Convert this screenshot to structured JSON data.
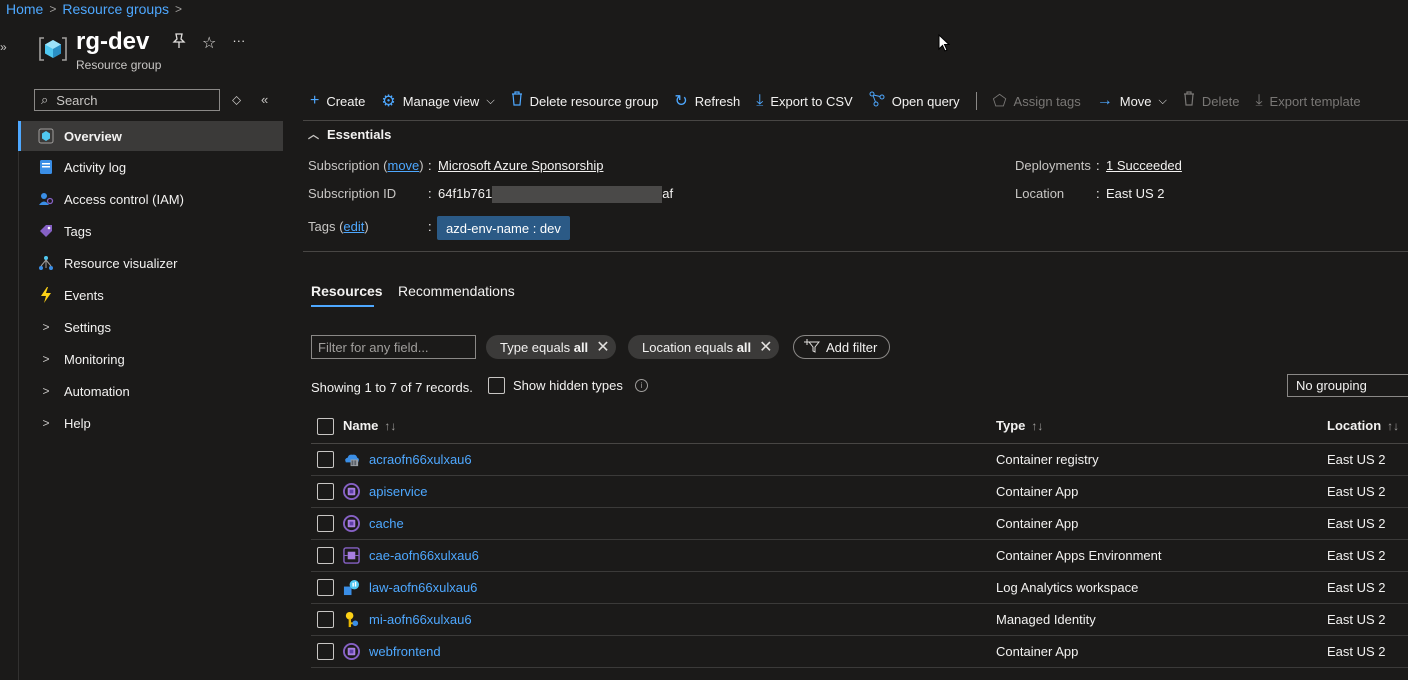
{
  "breadcrumb": {
    "home": "Home",
    "resource_groups": "Resource groups"
  },
  "header": {
    "title": "rg-dev",
    "subtitle": "Resource group",
    "more": "···"
  },
  "sidebar": {
    "search_placeholder": "Search",
    "items": [
      {
        "label": "Overview",
        "icon": "overview-icon"
      },
      {
        "label": "Activity log",
        "icon": "activity-log-icon"
      },
      {
        "label": "Access control (IAM)",
        "icon": "iam-icon"
      },
      {
        "label": "Tags",
        "icon": "tag-icon"
      },
      {
        "label": "Resource visualizer",
        "icon": "visualizer-icon"
      },
      {
        "label": "Events",
        "icon": "lightning-icon"
      },
      {
        "label": "Settings",
        "icon": "chevron-right-icon"
      },
      {
        "label": "Monitoring",
        "icon": "chevron-right-icon"
      },
      {
        "label": "Automation",
        "icon": "chevron-right-icon"
      },
      {
        "label": "Help",
        "icon": "chevron-right-icon"
      }
    ]
  },
  "toolbar": {
    "create": "Create",
    "manage_view": "Manage view",
    "delete_rg": "Delete resource group",
    "refresh": "Refresh",
    "export_csv": "Export to CSV",
    "open_query": "Open query",
    "assign_tags": "Assign tags",
    "move": "Move",
    "delete": "Delete",
    "export_template": "Export template"
  },
  "essentials": {
    "heading": "Essentials",
    "subscription_label": "Subscription (",
    "subscription_move": "move",
    "subscription_label_end": ")",
    "subscription_value": "Microsoft Azure Sponsorship",
    "subscription_id_label": "Subscription ID",
    "subscription_id_start": "64f1b761",
    "subscription_id_end": "af",
    "tags_label": "Tags (",
    "tags_edit": "edit",
    "tags_label_end": ")",
    "tag_value": "azd-env-name : dev",
    "deployments_label": "Deployments",
    "deployments_value": "1 Succeeded",
    "location_label": "Location",
    "location_value": "East US 2"
  },
  "tabs": {
    "resources": "Resources",
    "recommendations": "Recommendations"
  },
  "filters": {
    "placeholder": "Filter for any field...",
    "type_pill_prefix": "Type equals ",
    "type_pill_value": "all",
    "location_pill_prefix": "Location equals ",
    "location_pill_value": "all",
    "add_filter": "Add filter"
  },
  "records_text": "Showing 1 to 7 of 7 records.",
  "show_hidden_types": "Show hidden types",
  "grouping": "No grouping",
  "table": {
    "headers": {
      "name": "Name",
      "type": "Type",
      "location": "Location"
    },
    "rows": [
      {
        "name": "acraofn66xulxau6",
        "type": "Container registry",
        "location": "East US 2",
        "icon": "container-registry-icon"
      },
      {
        "name": "apiservice",
        "type": "Container App",
        "location": "East US 2",
        "icon": "container-app-icon"
      },
      {
        "name": "cache",
        "type": "Container App",
        "location": "East US 2",
        "icon": "container-app-icon"
      },
      {
        "name": "cae-aofn66xulxau6",
        "type": "Container Apps Environment",
        "location": "East US 2",
        "icon": "container-apps-environment-icon"
      },
      {
        "name": "law-aofn66xulxau6",
        "type": "Log Analytics workspace",
        "location": "East US 2",
        "icon": "log-analytics-icon"
      },
      {
        "name": "mi-aofn66xulxau6",
        "type": "Managed Identity",
        "location": "East US 2",
        "icon": "managed-identity-icon"
      },
      {
        "name": "webfrontend",
        "type": "Container App",
        "location": "East US 2",
        "icon": "container-app-icon"
      }
    ]
  },
  "colors": {
    "accent": "#4ea8ff",
    "background": "#1b1a19",
    "tag_chip": "#2b5a86"
  }
}
